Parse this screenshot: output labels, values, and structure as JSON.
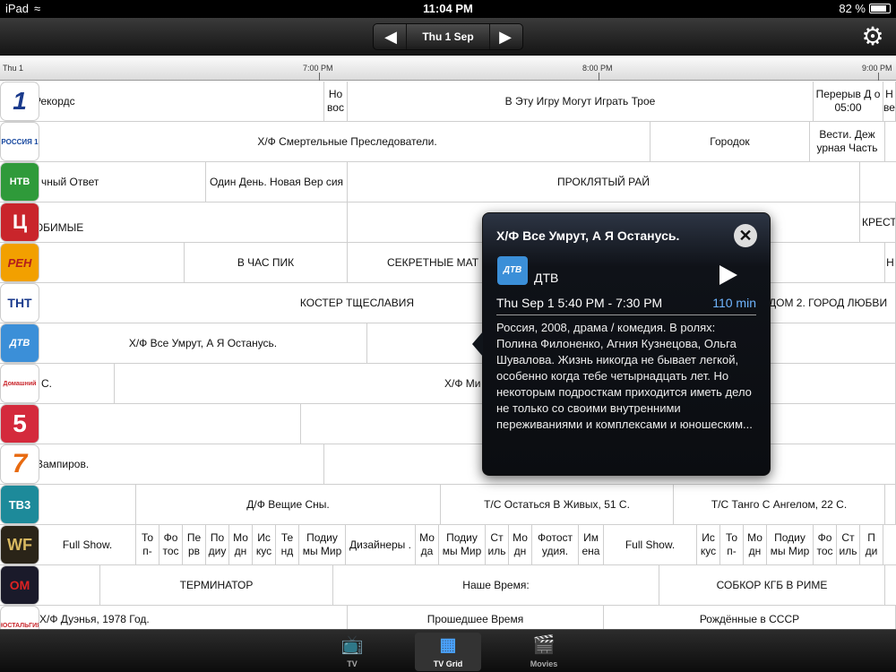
{
  "status": {
    "device": "iPad",
    "time": "11:04 PM",
    "battery": "82 %",
    "wifi_icon": "wifi-icon"
  },
  "nav": {
    "date": "Thu 1 Sep",
    "prev_icon": "left-arrow-icon",
    "next_icon": "right-arrow-icon",
    "settings_icon": "gear-icon"
  },
  "timebar": {
    "day": "Thu 1",
    "t1": "7:00 PM",
    "t2": "8:00 PM",
    "t3": "9:00 PM"
  },
  "rows": [
    {
      "logo": "1",
      "cells": [
        "Рекордс",
        "Но вос",
        "В Эту Игру Могут Играть Трое",
        "Перерыв Д о 05:00",
        "Н ве"
      ]
    },
    {
      "logo": "РОССИЯ 1",
      "cells": [
        "Х/Ф Смертельные Преследователи.",
        "Городок",
        "Вести. Деж урная Часть"
      ]
    },
    {
      "logo": "НТВ",
      "cells": [
        "чный Ответ",
        "Один День. Новая Вер сия",
        "ПРОКЛЯТЫЙ РАЙ"
      ]
    },
    {
      "logo": "Ц",
      "cells": [
        "ЮБИМЫЕ",
        "КРЕСТ"
      ]
    },
    {
      "logo": "РЕН",
      "cells": [
        "В ЧАС ПИК",
        "СЕКРЕТНЫЕ МАТ",
        "Н"
      ]
    },
    {
      "logo": "ТНТ",
      "cells": [
        "КОСТЕР ТЩЕСЛАВИЯ",
        "ДОМ 2. ГОРОД ЛЮБВИ"
      ]
    },
    {
      "logo": "ДТВ",
      "cells": [
        "Х/Ф Все Умрут, А Я Останусь."
      ]
    },
    {
      "logo": "Домашний",
      "cells": [
        "С.",
        "Х/Ф Ми"
      ]
    },
    {
      "logo": "5",
      "cells": []
    },
    {
      "logo": "7",
      "cells": [
        "Вампиров."
      ]
    },
    {
      "logo": "ТВ3",
      "cells": [
        "Д/Ф Вещие Сны.",
        "Т/С Остаться В Живых, 51 С.",
        "Т/С Танго С Ангелом, 22 С."
      ]
    },
    {
      "logo": "WF",
      "cells": [
        "Full Show.",
        "То п-",
        "Фо тос",
        "Пе рв",
        "По диу",
        "Мо дн",
        "Ис кус",
        "Те нд",
        "Подиу мы Мир",
        "Дизайнеры .",
        "Мо да",
        "Подиу мы Мир",
        "Ст иль",
        "Мо дн",
        "Фотост удия.",
        "Им ена",
        "Full Show.",
        "Ис кус",
        "То п-",
        "Мо дн",
        "Подиу мы Мир",
        "Фо тос",
        "Ст иль",
        "П ди"
      ]
    },
    {
      "logo": "ОМ",
      "cells": [
        "ТЕРМИНАТОР",
        "Наше Время:",
        "СОБКОР КГБ В РИМЕ"
      ]
    },
    {
      "logo": "НОСТАЛЬГИЯ",
      "cells": [
        "Х/Ф Дуэнья, 1978 Год.",
        "Прошедшее Время",
        "Рождённые в СССР"
      ]
    }
  ],
  "popover": {
    "title": "Х/Ф Все Умрут, А Я Останусь.",
    "channel": "ДТВ",
    "channel_logo": "ДТВ",
    "time": "Thu Sep 1 5:40 PM - 7:30 PM",
    "duration": "110 min",
    "description": "Россия, 2008, драма / комедия. В ролях: Полина Филоненко, Агния Кузнецова, Ольга Шувалова. Жизнь никогда не бывает легкой, особенно когда тебе четырнадцать лет. Но некоторым подросткам приходится иметь дело не только со своими внутренними переживаниями и комплексами и юношеским..."
  },
  "tabs": [
    {
      "label": "TV",
      "icon": "tv-icon"
    },
    {
      "label": "TV Grid",
      "icon": "grid-calendar-icon"
    },
    {
      "label": "Movies",
      "icon": "clapperboard-icon"
    }
  ],
  "colors": {
    "accent": "#6fb5ff",
    "nav_bg": "#1c1c1c"
  }
}
